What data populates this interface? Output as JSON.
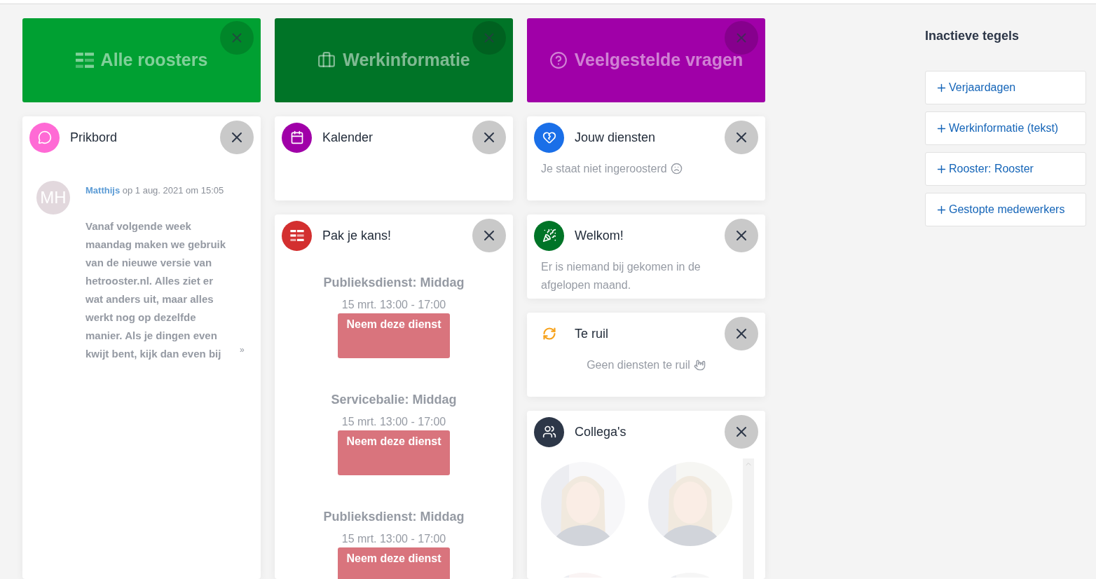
{
  "tiles": [
    {
      "title": "Alle roosters",
      "color": "#00a032"
    },
    {
      "title": "Werkinformatie",
      "color": "#007427"
    },
    {
      "title": "Veelgestelde vragen",
      "color": "#a000a8"
    }
  ],
  "columns": [
    [
      {
        "kind": "message",
        "title": "Prikbord",
        "color": "#ff6ad5",
        "initials": "MH",
        "author": "Matthijs",
        "meta": "op 1 aug. 2021 om 15:05",
        "text": "Vanaf volgende week maandag maken we gebruik van de nieuwe versie van hetrooster.nl. Alles ziet er wat anders uit, maar alles werkt nog op dezelfde manier. Als je dingen even kwijt bent, kijk dan even bij",
        "more": "»"
      }
    ],
    [
      {
        "kind": "note",
        "title": "Kalender",
        "color": "#a000a8"
      },
      {
        "kind": "shifts",
        "title": "Pak je kans!",
        "color": "#d32f2f",
        "shifts": [
          {
            "name": "Publieksdienst: Middag",
            "time": "15 mrt. 13:00 - 17:00",
            "action": "Neem deze dienst"
          },
          {
            "name": "Servicebalie: Middag",
            "time": "15 mrt. 13:00 - 17:00",
            "action": "Neem deze dienst"
          },
          {
            "name": "Publieksdienst: Middag",
            "time": "15 mrt. 13:00 - 17:00",
            "action": "Neem deze dienst"
          }
        ]
      }
    ],
    [
      {
        "kind": "note",
        "title": "Jouw diensten",
        "color": "#1a6fe8",
        "text": "Je staat niet ingeroosterd"
      },
      {
        "kind": "note",
        "title": "Welkom!",
        "color": "#007427",
        "text": "Er is niemand bij gekomen in de afgelopen maand."
      },
      {
        "kind": "centered_note",
        "title": "Te ruil",
        "color": "#f7a21b",
        "text": "Geen diensten te ruil"
      },
      {
        "kind": "people",
        "title": "Collega's",
        "color": "#2d3748"
      }
    ]
  ],
  "sidebar": {
    "title": "Inactieve tegels",
    "items": [
      "Verjaardagen",
      "Werkinformatie (tekst)",
      "Rooster: Rooster",
      "Gestopte medewerkers"
    ]
  }
}
